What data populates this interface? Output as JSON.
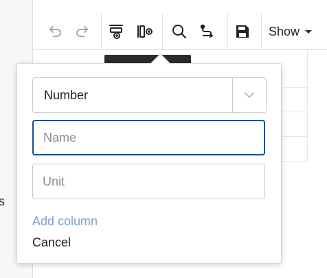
{
  "sidebar": {
    "partial_text": "s"
  },
  "toolbar": {
    "undo_icon": "undo-icon",
    "redo_icon": "redo-icon",
    "add_row_icon": "add-row-icon",
    "add_column_icon": "add-column-icon",
    "search_icon": "search-icon",
    "route_icon": "route-icon",
    "save_icon": "save-icon",
    "show_label": "Show"
  },
  "popover": {
    "type_select": {
      "value": "Number"
    },
    "name_field": {
      "placeholder": "Name",
      "value": ""
    },
    "unit_field": {
      "placeholder": "Unit",
      "value": ""
    },
    "add_label": "Add column",
    "cancel_label": "Cancel"
  },
  "colors": {
    "accent_focus": "#1d4e8f",
    "link": "#7a9fd1",
    "tooltip": "#2b2b2b"
  }
}
